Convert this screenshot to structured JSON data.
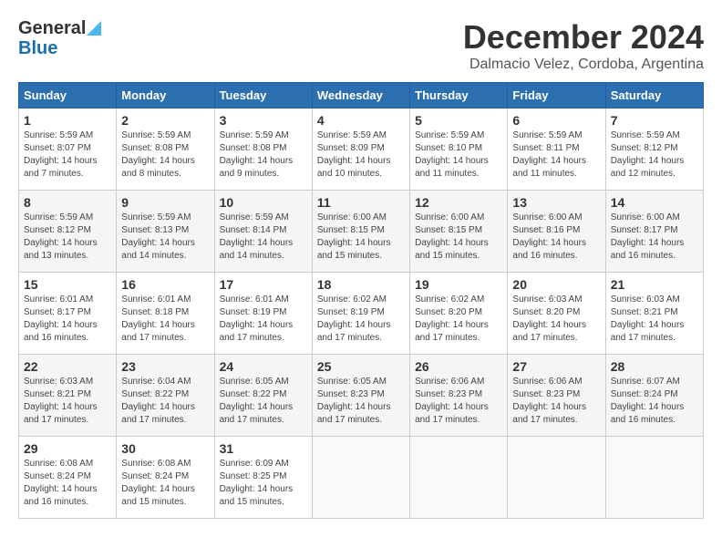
{
  "logo": {
    "line1": "General",
    "line2": "Blue",
    "tagline": ""
  },
  "title": "December 2024",
  "subtitle": "Dalmacio Velez, Cordoba, Argentina",
  "days_of_week": [
    "Sunday",
    "Monday",
    "Tuesday",
    "Wednesday",
    "Thursday",
    "Friday",
    "Saturday"
  ],
  "weeks": [
    [
      {
        "day": "1",
        "sunrise": "5:59 AM",
        "sunset": "8:07 PM",
        "daylight": "14 hours and 7 minutes."
      },
      {
        "day": "2",
        "sunrise": "5:59 AM",
        "sunset": "8:08 PM",
        "daylight": "14 hours and 8 minutes."
      },
      {
        "day": "3",
        "sunrise": "5:59 AM",
        "sunset": "8:08 PM",
        "daylight": "14 hours and 9 minutes."
      },
      {
        "day": "4",
        "sunrise": "5:59 AM",
        "sunset": "8:09 PM",
        "daylight": "14 hours and 10 minutes."
      },
      {
        "day": "5",
        "sunrise": "5:59 AM",
        "sunset": "8:10 PM",
        "daylight": "14 hours and 11 minutes."
      },
      {
        "day": "6",
        "sunrise": "5:59 AM",
        "sunset": "8:11 PM",
        "daylight": "14 hours and 11 minutes."
      },
      {
        "day": "7",
        "sunrise": "5:59 AM",
        "sunset": "8:12 PM",
        "daylight": "14 hours and 12 minutes."
      }
    ],
    [
      {
        "day": "8",
        "sunrise": "5:59 AM",
        "sunset": "8:12 PM",
        "daylight": "14 hours and 13 minutes."
      },
      {
        "day": "9",
        "sunrise": "5:59 AM",
        "sunset": "8:13 PM",
        "daylight": "14 hours and 14 minutes."
      },
      {
        "day": "10",
        "sunrise": "5:59 AM",
        "sunset": "8:14 PM",
        "daylight": "14 hours and 14 minutes."
      },
      {
        "day": "11",
        "sunrise": "6:00 AM",
        "sunset": "8:15 PM",
        "daylight": "14 hours and 15 minutes."
      },
      {
        "day": "12",
        "sunrise": "6:00 AM",
        "sunset": "8:15 PM",
        "daylight": "14 hours and 15 minutes."
      },
      {
        "day": "13",
        "sunrise": "6:00 AM",
        "sunset": "8:16 PM",
        "daylight": "14 hours and 16 minutes."
      },
      {
        "day": "14",
        "sunrise": "6:00 AM",
        "sunset": "8:17 PM",
        "daylight": "14 hours and 16 minutes."
      }
    ],
    [
      {
        "day": "15",
        "sunrise": "6:01 AM",
        "sunset": "8:17 PM",
        "daylight": "14 hours and 16 minutes."
      },
      {
        "day": "16",
        "sunrise": "6:01 AM",
        "sunset": "8:18 PM",
        "daylight": "14 hours and 17 minutes."
      },
      {
        "day": "17",
        "sunrise": "6:01 AM",
        "sunset": "8:19 PM",
        "daylight": "14 hours and 17 minutes."
      },
      {
        "day": "18",
        "sunrise": "6:02 AM",
        "sunset": "8:19 PM",
        "daylight": "14 hours and 17 minutes."
      },
      {
        "day": "19",
        "sunrise": "6:02 AM",
        "sunset": "8:20 PM",
        "daylight": "14 hours and 17 minutes."
      },
      {
        "day": "20",
        "sunrise": "6:03 AM",
        "sunset": "8:20 PM",
        "daylight": "14 hours and 17 minutes."
      },
      {
        "day": "21",
        "sunrise": "6:03 AM",
        "sunset": "8:21 PM",
        "daylight": "14 hours and 17 minutes."
      }
    ],
    [
      {
        "day": "22",
        "sunrise": "6:03 AM",
        "sunset": "8:21 PM",
        "daylight": "14 hours and 17 minutes."
      },
      {
        "day": "23",
        "sunrise": "6:04 AM",
        "sunset": "8:22 PM",
        "daylight": "14 hours and 17 minutes."
      },
      {
        "day": "24",
        "sunrise": "6:05 AM",
        "sunset": "8:22 PM",
        "daylight": "14 hours and 17 minutes."
      },
      {
        "day": "25",
        "sunrise": "6:05 AM",
        "sunset": "8:23 PM",
        "daylight": "14 hours and 17 minutes."
      },
      {
        "day": "26",
        "sunrise": "6:06 AM",
        "sunset": "8:23 PM",
        "daylight": "14 hours and 17 minutes."
      },
      {
        "day": "27",
        "sunrise": "6:06 AM",
        "sunset": "8:23 PM",
        "daylight": "14 hours and 17 minutes."
      },
      {
        "day": "28",
        "sunrise": "6:07 AM",
        "sunset": "8:24 PM",
        "daylight": "14 hours and 16 minutes."
      }
    ],
    [
      {
        "day": "29",
        "sunrise": "6:08 AM",
        "sunset": "8:24 PM",
        "daylight": "14 hours and 16 minutes."
      },
      {
        "day": "30",
        "sunrise": "6:08 AM",
        "sunset": "8:24 PM",
        "daylight": "14 hours and 15 minutes."
      },
      {
        "day": "31",
        "sunrise": "6:09 AM",
        "sunset": "8:25 PM",
        "daylight": "14 hours and 15 minutes."
      },
      null,
      null,
      null,
      null
    ]
  ]
}
